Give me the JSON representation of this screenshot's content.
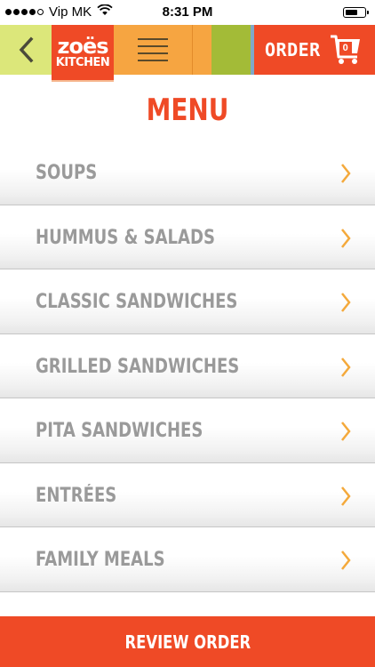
{
  "status_bar": {
    "carrier": "Vip MK",
    "time": "8:31 PM",
    "signal_bars_filled": 4,
    "signal_bars_total": 5,
    "wifi_icon": "wifi-icon",
    "battery_level": 0.5
  },
  "header": {
    "back_icon": "chevron-left-icon",
    "logo_top": "zoës",
    "logo_bottom": "KITCHEN",
    "menu_icon": "hamburger-icon",
    "order_label": "ORDER",
    "cart_icon": "cart-icon",
    "cart_count": "0"
  },
  "title": "MENU",
  "menu_items": [
    {
      "label": "SOUPS"
    },
    {
      "label": "HUMMUS & SALADS"
    },
    {
      "label": "CLASSIC SANDWICHES"
    },
    {
      "label": "GRILLED SANDWICHES"
    },
    {
      "label": "PITA SANDWICHES"
    },
    {
      "label": "ENTRÉES"
    },
    {
      "label": "FAMILY MEALS"
    }
  ],
  "review_button": "REVIEW ORDER",
  "colors": {
    "brand_red": "#ef4a26",
    "lime": "#dce77a",
    "orange": "#f6a541",
    "green": "#a3bb37",
    "chevron": "#f4a93b",
    "item_text": "#9a9a9a"
  }
}
